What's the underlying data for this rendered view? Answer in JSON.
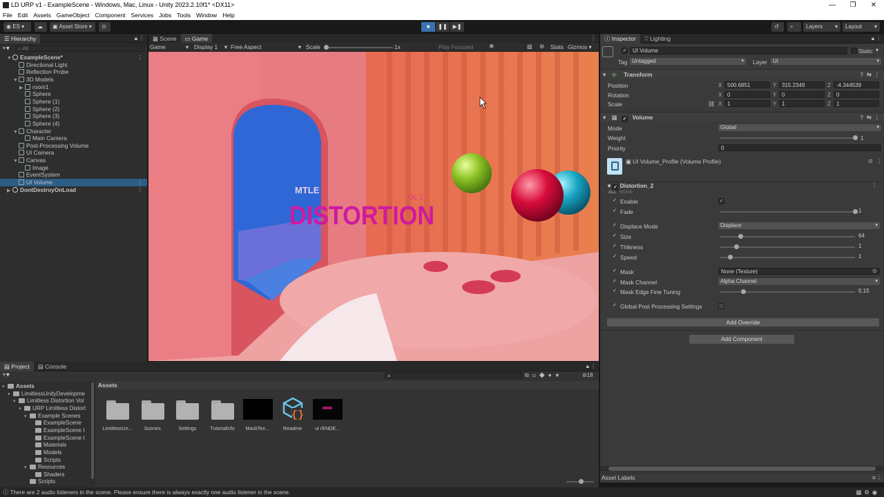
{
  "window": {
    "title": "LD URP v1 - ExampleScene - Windows, Mac, Linux - Unity 2023.2.10f1* <DX11>",
    "controls": [
      "—",
      "❐",
      "✕"
    ]
  },
  "menu": [
    "File",
    "Edit",
    "Assets",
    "GameObject",
    "Component",
    "Services",
    "Jobs",
    "Tools",
    "Window",
    "Help"
  ],
  "toolbar": {
    "account": "ES",
    "asset_store": "Asset Store",
    "layers": "Layers",
    "layout": "Layout"
  },
  "hierarchy": {
    "tab": "Hierarchy",
    "search_placeholder": "All",
    "rows": [
      {
        "label": "ExampleScene*",
        "indent": 0
      },
      {
        "label": "Directional Light",
        "indent": 1
      },
      {
        "label": "Reflection Probe",
        "indent": 1
      },
      {
        "label": "3D Models",
        "indent": 1
      },
      {
        "label": "room1",
        "indent": 2
      },
      {
        "label": "Sphere",
        "indent": 2
      },
      {
        "label": "Sphere (1)",
        "indent": 2
      },
      {
        "label": "Sphere (2)",
        "indent": 2
      },
      {
        "label": "Sphere (3)",
        "indent": 2
      },
      {
        "label": "Sphere (4)",
        "indent": 2
      },
      {
        "label": "Character",
        "indent": 1
      },
      {
        "label": "Main Camera",
        "indent": 2
      },
      {
        "label": "Post-Processing Volume",
        "indent": 1
      },
      {
        "label": "UI Camera",
        "indent": 1
      },
      {
        "label": "Canvas",
        "indent": 1
      },
      {
        "label": "Image",
        "indent": 2
      },
      {
        "label": "EventSystem",
        "indent": 1
      },
      {
        "label": "UI Volume",
        "indent": 1,
        "selected": true
      },
      {
        "label": "DontDestroyOnLoad",
        "indent": 0
      }
    ]
  },
  "view_tabs": {
    "scene": "Scene",
    "game": "Game"
  },
  "game_bar": {
    "mode": "Game",
    "display": "Display 1",
    "aspect": "Free Aspect",
    "scale_label": "Scale",
    "scale_value": "1x",
    "play_focused": "Play Focused",
    "stats": "Stats",
    "gizmos": "Gizmos"
  },
  "game": {
    "overlay_top": "MTLE",
    "overlay_text": "DISTORTION",
    "overlay_small": "OL 1"
  },
  "inspector": {
    "tab": "Inspector",
    "lighting_tab": "Lighting",
    "object_name": "UI Volume",
    "static": "Static",
    "tag_label": "Tag",
    "tag_value": "Untagged",
    "layer_label": "Layer",
    "layer_value": "UI",
    "transform": {
      "title": "Transform",
      "position_label": "Position",
      "rotation_label": "Rotation",
      "scale_label": "Scale",
      "position": [
        "500.6851",
        "315.2349",
        "-4.344539"
      ],
      "rotation": [
        "0",
        "0",
        "0"
      ],
      "scale": [
        "1",
        "1",
        "1"
      ]
    },
    "volume": {
      "title": "Volume",
      "mode_label": "Mode",
      "mode_value": "Global",
      "weight_label": "Weight",
      "weight_value": "1",
      "priority_label": "Priority",
      "priority_value": "0",
      "profile": "UI Volume_Profile (Volume Profile)"
    },
    "distortion": {
      "title": "Distortion_2",
      "all": "ALL",
      "none": "NONE",
      "enable_label": "Enable",
      "fade_label": "Fade",
      "fade_value": "1",
      "displace_mode_label": "Displace Mode",
      "displace_mode_value": "Displace",
      "size_label": "Size",
      "size_value": "64",
      "thickness_label": "Thikness",
      "thickness_value": "1",
      "speed_label": "Speed",
      "speed_value": "1",
      "mask_label": "Mask",
      "mask_value": "None (Texture)",
      "mask_channel_label": "Mask Channel",
      "mask_channel_value": "Alpha Channel",
      "edge_label": "Mask Edge Fine Tuning",
      "edge_value": "0.15",
      "global_label": "Global Post Processing Settings"
    },
    "add_override": "Add Override",
    "add_component": "Add Component",
    "asset_labels": "Asset Labels"
  },
  "project": {
    "tab": "Project",
    "console_tab": "Console",
    "assets_header": "Assets",
    "tree": [
      {
        "label": "Assets",
        "indent": 0
      },
      {
        "label": "LimitlessUnityDevelopme",
        "indent": 1
      },
      {
        "label": "Limitless Distortion Vol",
        "indent": 2
      },
      {
        "label": "URP Limitless Distort",
        "indent": 3
      },
      {
        "label": "Example Scenes",
        "indent": 4
      },
      {
        "label": "ExampleScene",
        "indent": 5
      },
      {
        "label": "ExampleScene I",
        "indent": 5
      },
      {
        "label": "ExampleScene I",
        "indent": 5
      },
      {
        "label": "Materials",
        "indent": 5
      },
      {
        "label": "Models",
        "indent": 5
      },
      {
        "label": "Scripts",
        "indent": 5
      },
      {
        "label": "Resources",
        "indent": 4
      },
      {
        "label": "Shaders",
        "indent": 5
      },
      {
        "label": "Scripts",
        "indent": 4
      }
    ],
    "assets": [
      {
        "label": "LimitlessUn...",
        "kind": "folder"
      },
      {
        "label": "Scenes",
        "kind": "folder"
      },
      {
        "label": "Settings",
        "kind": "folder"
      },
      {
        "label": "TutorialInfo",
        "kind": "folder"
      },
      {
        "label": "MaskTex...",
        "kind": "black"
      },
      {
        "label": "Readme",
        "kind": "readme"
      },
      {
        "label": "ui rENDE...",
        "kind": "render"
      }
    ],
    "count": "18"
  },
  "status": "There are 2 audio listeners in the scene. Please ensure there is always exactly one audio listener in the scene."
}
